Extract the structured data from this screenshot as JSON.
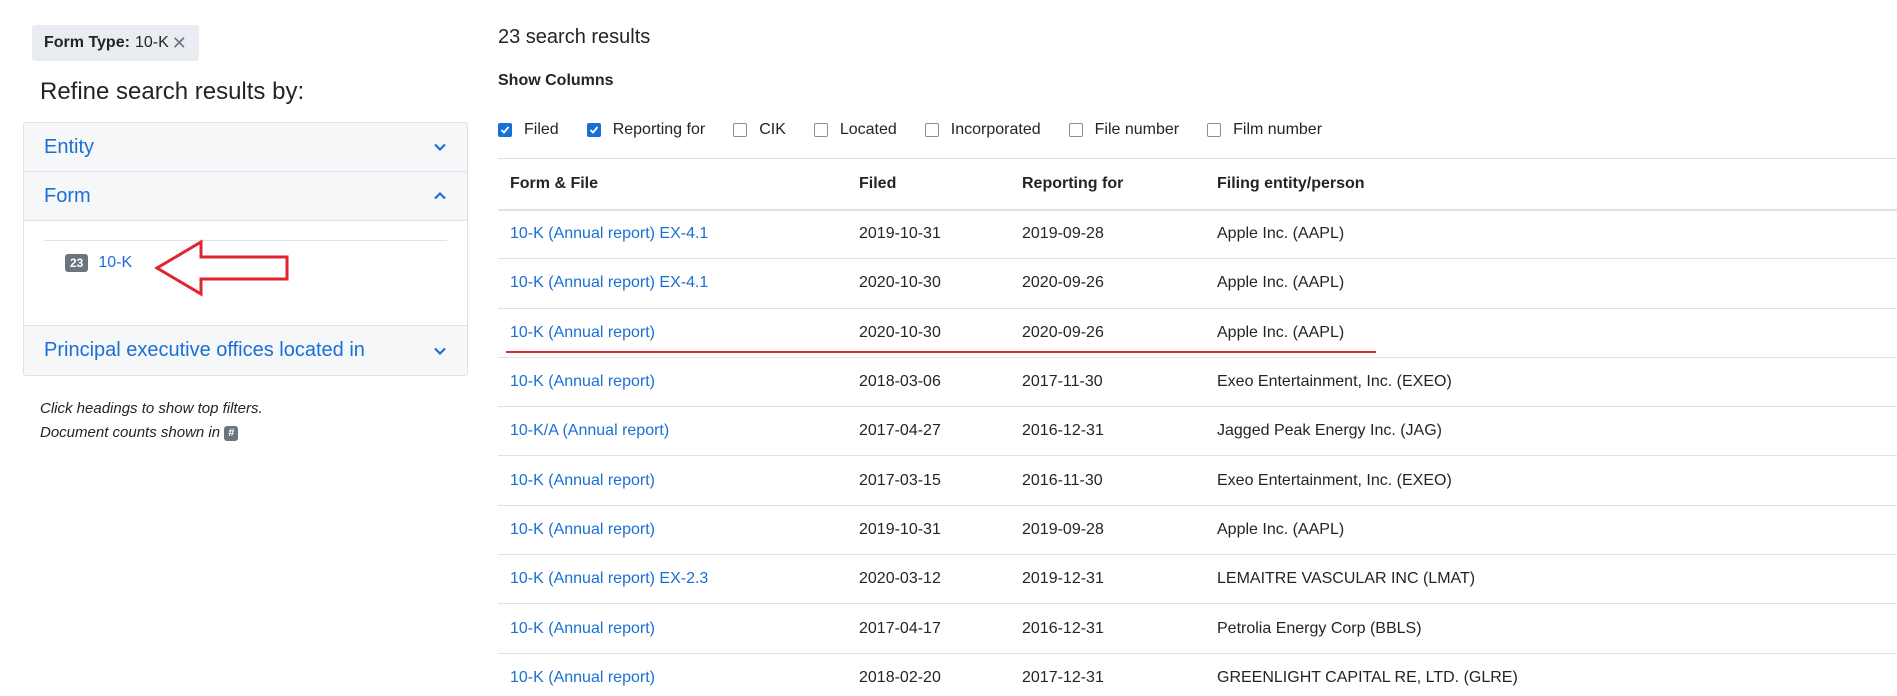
{
  "sidebar": {
    "filter_pill": {
      "label": "Form Type:",
      "value": "10-K"
    },
    "heading": "Refine search results by:",
    "sections": [
      {
        "title": "Entity",
        "expanded": false
      },
      {
        "title": "Form",
        "expanded": true,
        "items": [
          {
            "count": "23",
            "label": "10-K"
          }
        ]
      },
      {
        "title": "Principal executive offices located in",
        "expanded": false
      }
    ],
    "note_line1": "Click headings to show top filters.",
    "note_line2": "Document counts shown in",
    "note_badge": "#"
  },
  "main": {
    "results_count": "23 search results",
    "show_columns_label": "Show Columns",
    "column_options": [
      {
        "label": "Filed",
        "checked": true
      },
      {
        "label": "Reporting for",
        "checked": true
      },
      {
        "label": "CIK",
        "checked": false
      },
      {
        "label": "Located",
        "checked": false
      },
      {
        "label": "Incorporated",
        "checked": false
      },
      {
        "label": "File number",
        "checked": false
      },
      {
        "label": "Film number",
        "checked": false
      }
    ],
    "table": {
      "headers": [
        "Form & File",
        "Filed",
        "Reporting for",
        "Filing entity/person"
      ],
      "rows": [
        [
          "10-K (Annual report) EX-4.1",
          "2019-10-31",
          "2019-09-28",
          "Apple Inc. (AAPL)"
        ],
        [
          "10-K (Annual report) EX-4.1",
          "2020-10-30",
          "2020-09-26",
          "Apple Inc. (AAPL)"
        ],
        [
          "10-K (Annual report)",
          "2020-10-30",
          "2020-09-26",
          "Apple Inc. (AAPL)"
        ],
        [
          "10-K (Annual report)",
          "2018-03-06",
          "2017-11-30",
          "Exeo Entertainment, Inc. (EXEO)"
        ],
        [
          "10-K/A (Annual report)",
          "2017-04-27",
          "2016-12-31",
          "Jagged Peak Energy Inc. (JAG)"
        ],
        [
          "10-K (Annual report)",
          "2017-03-15",
          "2016-11-30",
          "Exeo Entertainment, Inc. (EXEO)"
        ],
        [
          "10-K (Annual report)",
          "2019-10-31",
          "2019-09-28",
          "Apple Inc. (AAPL)"
        ],
        [
          "10-K (Annual report) EX-2.3",
          "2020-03-12",
          "2019-12-31",
          "LEMAITRE VASCULAR INC (LMAT)"
        ],
        [
          "10-K (Annual report)",
          "2017-04-17",
          "2016-12-31",
          "Petrolia Energy Corp (BBLS)"
        ],
        [
          "10-K (Annual report)",
          "2018-02-20",
          "2017-12-31",
          "GREENLIGHT CAPITAL RE, LTD. (GLRE)"
        ]
      ]
    }
  },
  "colors": {
    "link": "#1a6fd6",
    "annotation": "#e0252f",
    "badge": "#6c757d"
  }
}
